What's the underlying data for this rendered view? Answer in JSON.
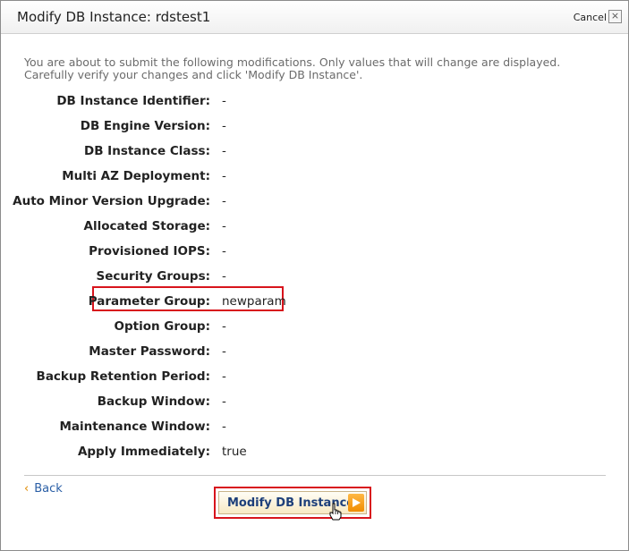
{
  "dialog": {
    "title": "Modify DB Instance: rdstest1",
    "cancel_label": "Cancel",
    "close_glyph": "×",
    "intro_line1": "You are about to submit the following modifications. Only values that will change are displayed.",
    "intro_line2": "Carefully verify your changes and click 'Modify DB Instance'."
  },
  "fields": [
    {
      "label": "DB Instance Identifier:",
      "value": "-"
    },
    {
      "label": "DB Engine Version:",
      "value": "-"
    },
    {
      "label": "DB Instance Class:",
      "value": "-"
    },
    {
      "label": "Multi AZ Deployment:",
      "value": "-"
    },
    {
      "label": "Auto Minor Version Upgrade:",
      "value": "-"
    },
    {
      "label": "Allocated Storage:",
      "value": "-"
    },
    {
      "label": "Provisioned IOPS:",
      "value": "-"
    },
    {
      "label": "Security Groups:",
      "value": "-"
    },
    {
      "label": "Parameter Group:",
      "value": "newparam"
    },
    {
      "label": "Option Group:",
      "value": "-"
    },
    {
      "label": "Master Password:",
      "value": "-"
    },
    {
      "label": "Backup Retention Period:",
      "value": "-"
    },
    {
      "label": "Backup Window:",
      "value": "-"
    },
    {
      "label": "Maintenance Window:",
      "value": "-"
    },
    {
      "label": "Apply Immediately:",
      "value": "true"
    }
  ],
  "footer": {
    "back_chevron": "‹",
    "back_label": "Back",
    "submit_label": "Modify DB Instance"
  },
  "colors": {
    "highlight": "#d8141c",
    "link": "#2b5fa6",
    "button_text": "#1d3f7a",
    "button_arrow": "#f08c00"
  },
  "icons": {
    "close": "close-icon",
    "submit_arrow": "play-arrow-icon",
    "cursor": "hand-pointer-icon"
  }
}
